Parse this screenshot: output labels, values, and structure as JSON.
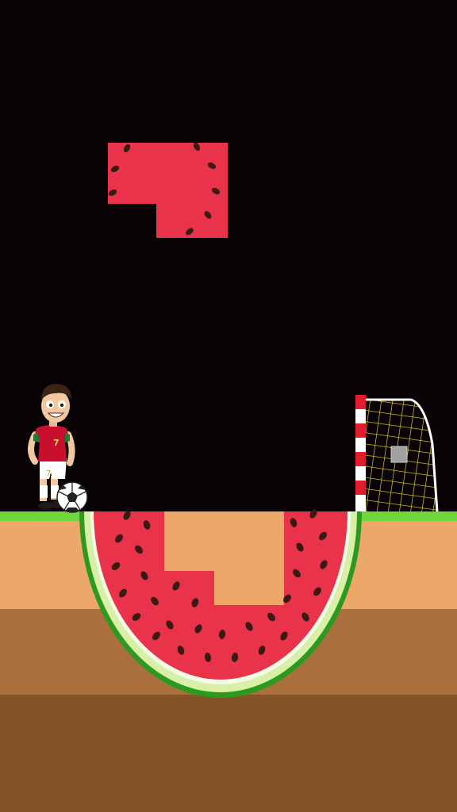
{
  "game": {
    "player": {
      "jersey_number": "7",
      "shorts_number": "7"
    },
    "colors": {
      "background": "#0a0305",
      "grass": "#6fd63a",
      "soil_light": "#eba868",
      "soil_mid": "#a9703d",
      "soil_dark": "#845328",
      "watermelon_flesh": "#e8334a",
      "watermelon_rind": "#2d9a1f",
      "seed": "#3a1a12",
      "jersey": "#c8102e",
      "goal_net": "#f0e020",
      "goal_post_red": "#e11d2d"
    },
    "icons": {
      "player": "soccer-player-icon",
      "ball": "soccer-ball-icon",
      "goal": "soccer-goal-icon"
    }
  }
}
